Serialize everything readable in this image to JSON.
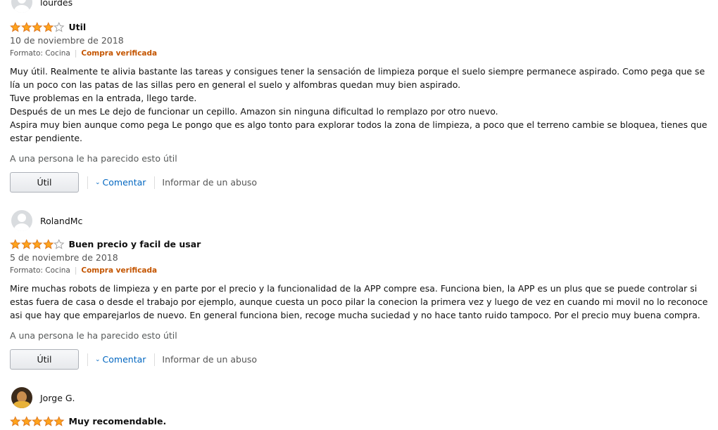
{
  "reviews": [
    {
      "name": "lourdes",
      "stars": 4,
      "title": "Util",
      "date": "10 de noviembre de 2018",
      "format": "Formato: Cocina",
      "verified": "Compra verificada",
      "paragraphs": [
        "Muy útil. Realmente te alivia bastante las tareas y consigues tener la sensación de limpieza porque el suelo siempre permanece aspirado. Como pega que se lía un poco con las patas de las sillas pero en general el suelo y alfombras quedan muy bien aspirado.",
        "Tuve problemas en la entrada, llego tarde.",
        "Después de un mes Le dejo de funcionar un cepillo. Amazon sin ninguna dificultad lo remplazo por otro nuevo.",
        "Aspira muy bien aunque como pega Le pongo que es algo tonto para explorar todos la zona de limpieza, a poco que el terreno cambie se bloquea, tienes que estar pendiente."
      ],
      "helpful": "A una persona le ha parecido esto útil",
      "util_label": "Útil",
      "comment_label": "Comentar",
      "abuse_label": "Informar de un abuso"
    },
    {
      "name": "RolandMc",
      "stars": 4,
      "title": "Buen precio y facil de usar",
      "date": "5 de noviembre de 2018",
      "format": "Formato: Cocina",
      "verified": "Compra verificada",
      "paragraphs": [
        "Mire muchas robots de limpieza y en parte por el precio y la funcionalidad de la APP compre esa. Funciona bien, la APP es un plus que se puede controlar si estas fuera de casa o desde el trabajo por ejemplo, aunque cuesta un poco pilar la conecion la primera vez y luego de vez en cuando mi movil no lo reconoce asi que hay que emparejarlos de nuevo. En general funciona bien, recoge mucha suciedad y no hace tanto ruido tampoco. Por el precio muy buena compra."
      ],
      "helpful": "A una persona le ha parecido esto útil",
      "util_label": "Útil",
      "comment_label": "Comentar",
      "abuse_label": "Informar de un abuso"
    },
    {
      "name": "Jorge G.",
      "stars": 5,
      "title": "Muy recomendable."
    }
  ],
  "colors": {
    "star_fill": "#ffa41c",
    "star_stroke": "#de7921",
    "verified": "#c45500",
    "link": "#0066c0"
  }
}
